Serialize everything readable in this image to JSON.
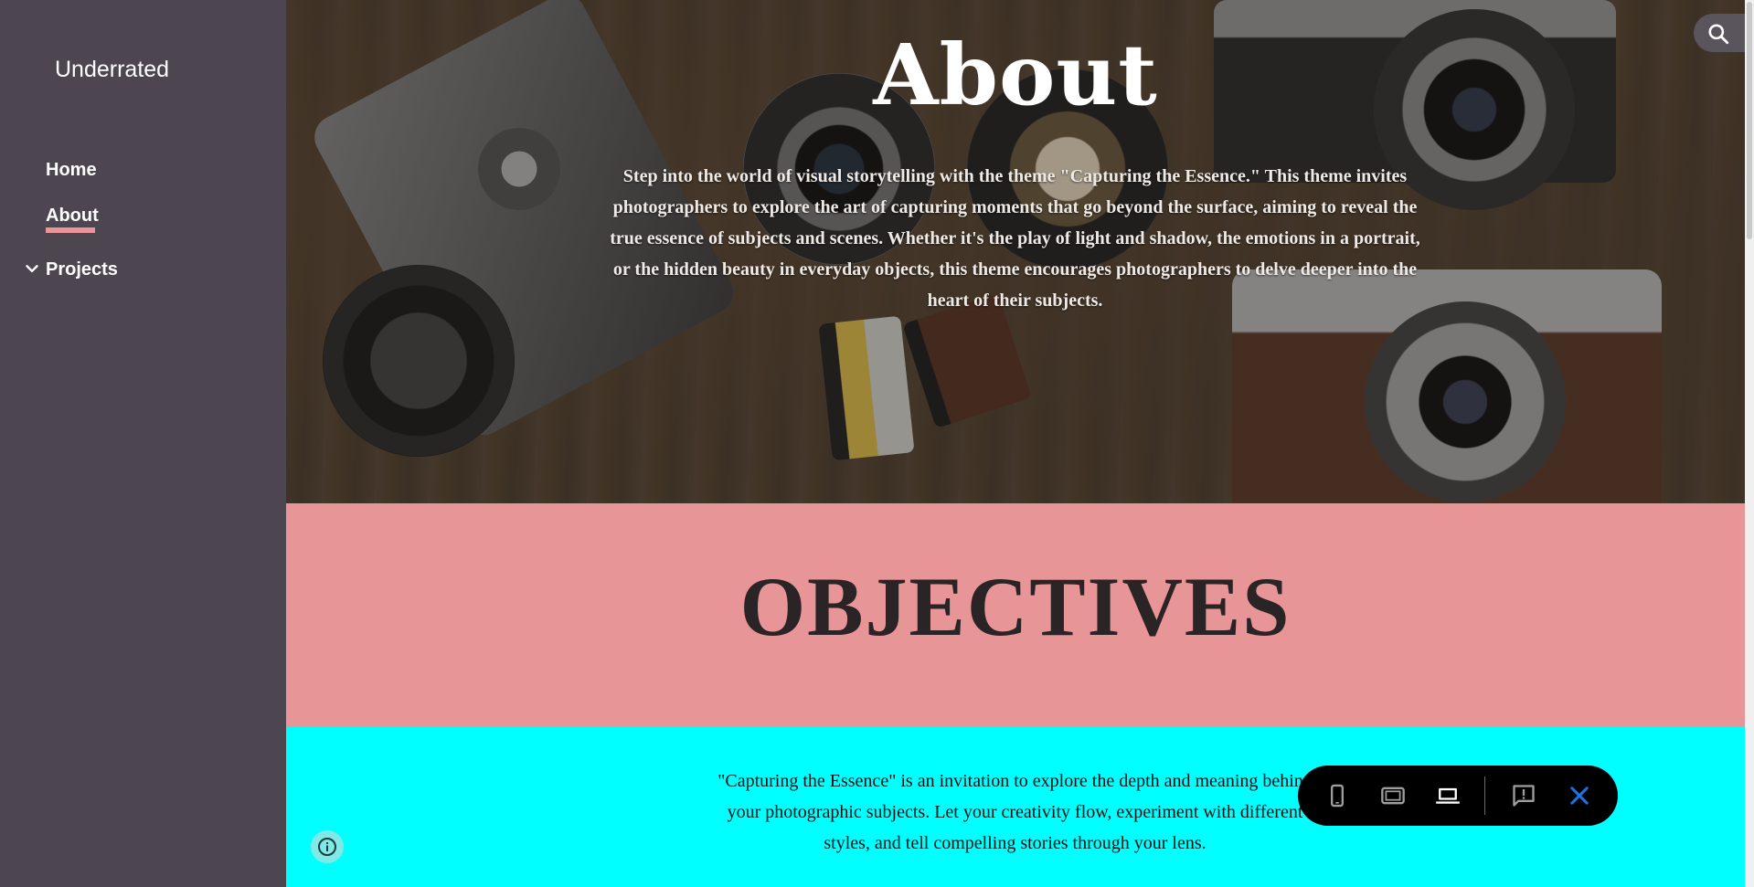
{
  "site": {
    "title": "Underrated"
  },
  "nav": {
    "items": [
      {
        "label": "Home"
      },
      {
        "label": "About"
      },
      {
        "label": "Projects"
      }
    ],
    "active": "About"
  },
  "hero": {
    "title": "About",
    "text": "Step into the world of visual storytelling with the theme \"Capturing the Essence.\" This theme invites photographers to explore the art of capturing moments that go beyond the surface, aiming to reveal the true essence of subjects and scenes. Whether it's the play of light and shadow, the emotions in a portrait, or the hidden beauty in everyday objects, this theme encourages photographers to delve deeper into the heart of their subjects."
  },
  "objectives": {
    "title": "OBJECTIVES"
  },
  "intro": {
    "text": "\"Capturing the Essence\" is an invitation to explore the depth and meaning behind your photographic subjects. Let your creativity flow, experiment with different styles, and tell compelling stories through your lens."
  },
  "toolbar": {
    "icons": [
      "phone-icon",
      "tablet-icon",
      "laptop-icon",
      "feedback-icon",
      "close-icon"
    ]
  },
  "colors": {
    "sidebar": "#4d4650",
    "accent": "#e89597",
    "cyan_section": "#00ffff",
    "toolbar_close": "#1a73e8"
  }
}
